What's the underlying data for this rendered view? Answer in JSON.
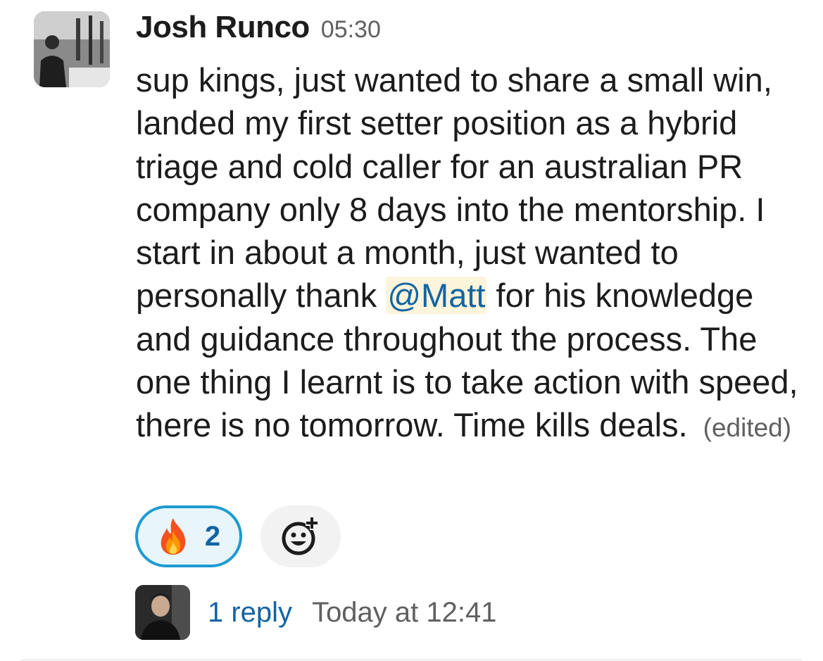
{
  "message": {
    "author": "Josh Runco",
    "timestamp": "05:30",
    "body_before_mention": "sup kings, just wanted to share a small win, landed my first setter position as a hybrid triage and cold caller for an australian PR company only 8 days into the mentorship. I start in about a month, just wanted to personally thank ",
    "mention": "@Matt",
    "body_after_mention": " for his knowledge and guidance throughout the process. The one thing I learnt is to take action with speed, there is no tomorrow. Time kills deals.",
    "edited_label": "(edited)",
    "avatar_icon": "user-avatar-photo"
  },
  "reactions": [
    {
      "emoji_icon": "fire-emoji-icon",
      "count": "2",
      "active": true
    }
  ],
  "add_reaction_icon": "add-reaction-icon",
  "thread": {
    "reply_label": "1 reply",
    "last_reply_time": "Today at 12:41",
    "avatar_icon": "replier-avatar-photo"
  },
  "colors": {
    "link": "#1264a3",
    "mention_bg": "#fcf4db",
    "reaction_border": "#1d9bd1",
    "reaction_bg": "#e8f5fa",
    "muted_text": "#616061"
  }
}
